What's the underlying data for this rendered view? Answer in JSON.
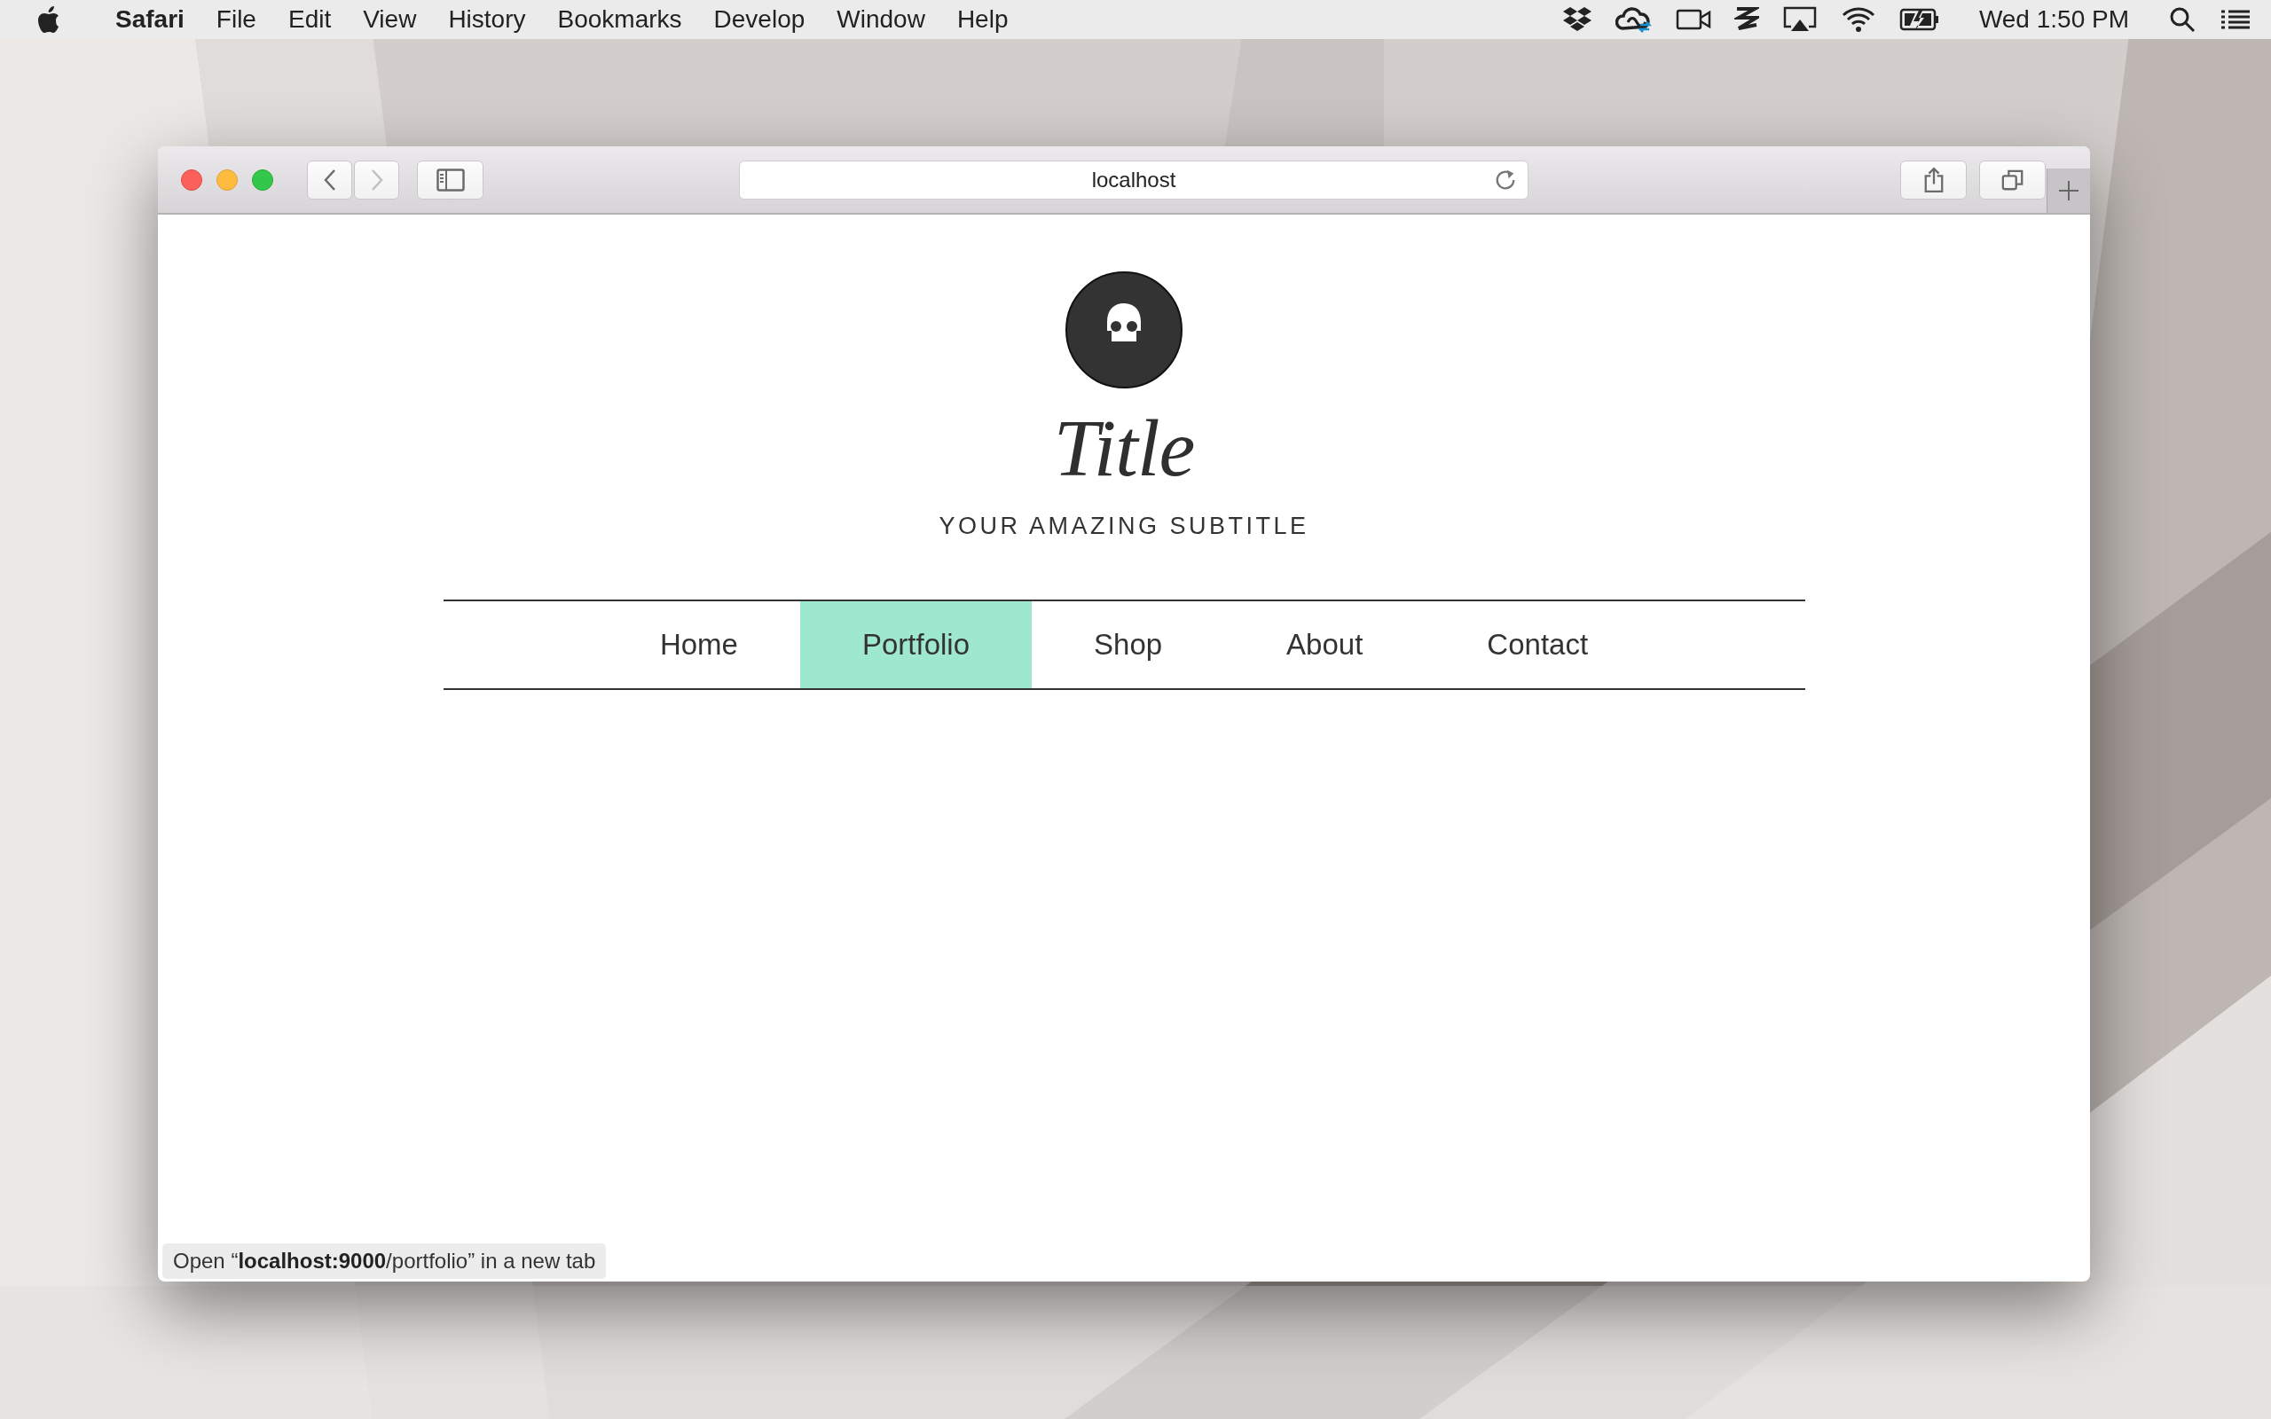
{
  "menu_bar": {
    "app": "Safari",
    "menus": [
      "File",
      "Edit",
      "View",
      "History",
      "Bookmarks",
      "Develop",
      "Window",
      "Help"
    ],
    "clock": "Wed 1:50 PM"
  },
  "browser": {
    "back": {
      "disabled": false
    },
    "forward": {
      "disabled": true
    },
    "address": "localhost",
    "status_link": "Open “**localhost:9000**/portfolio” in a new tab"
  },
  "page": {
    "title": "Title",
    "subtitle": "YOUR AMAZING SUBTITLE",
    "nav": [
      {
        "label": "Home",
        "selected": false
      },
      {
        "label": "Portfolio",
        "selected": true
      },
      {
        "label": "Shop",
        "selected": false
      },
      {
        "label": "About",
        "selected": false
      },
      {
        "label": "Contact",
        "selected": false
      }
    ]
  }
}
